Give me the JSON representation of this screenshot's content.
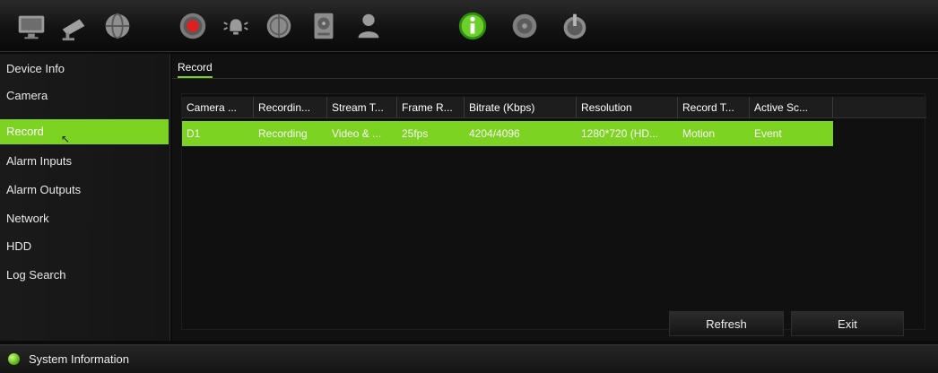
{
  "toolbar": {
    "icons": [
      "monitor-icon",
      "camera-icon",
      "globe-icon",
      "record-icon",
      "alarm-icon",
      "network-globe-icon",
      "storage-icon",
      "user-icon",
      "info-icon",
      "disk-icon",
      "power-icon"
    ],
    "active_icon": "info-icon"
  },
  "sidebar": {
    "items": [
      {
        "label": "Device Info"
      },
      {
        "label": "Camera"
      },
      {
        "label": "Record",
        "active": true
      },
      {
        "label": "Alarm Inputs"
      },
      {
        "label": "Alarm Outputs"
      },
      {
        "label": "Network"
      },
      {
        "label": "HDD"
      },
      {
        "label": "Log Search"
      }
    ]
  },
  "main": {
    "tab": "Record",
    "table": {
      "columns": [
        "Camera ...",
        "Recordin...",
        "Stream T...",
        "Frame R...",
        "Bitrate (Kbps)",
        "Resolution",
        "Record T...",
        "Active Sc..."
      ],
      "rows": [
        [
          "D1",
          "Recording",
          "Video & ...",
          "25fps",
          "4204/4096",
          "1280*720 (HD...",
          "Motion",
          "Event"
        ]
      ]
    },
    "buttons": {
      "refresh": "Refresh",
      "exit": "Exit"
    }
  },
  "statusbar": {
    "text": "System Information"
  },
  "colors": {
    "accent": "#7dd321",
    "background": "#0b0b0b"
  }
}
